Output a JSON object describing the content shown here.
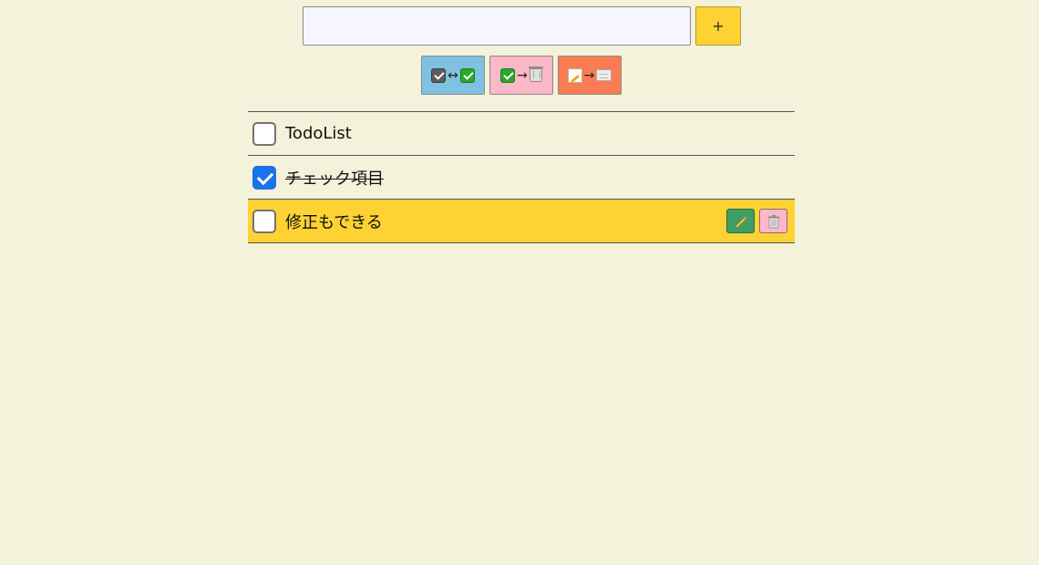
{
  "input": {
    "value": "",
    "placeholder": ""
  },
  "add_button": {
    "label": "+",
    "color": "#fed230"
  },
  "actions": [
    {
      "name": "toggle-all",
      "icons": [
        "check-box-gray-icon",
        "check-box-green-icon"
      ],
      "arrow": "↔",
      "color": "#7ec1e0"
    },
    {
      "name": "delete-checked",
      "icons": [
        "check-box-green-icon",
        "trash-icon"
      ],
      "arrow": "→",
      "color": "#fbb8c8"
    },
    {
      "name": "clear-all",
      "icons": [
        "memo-icon",
        "blank-sheet-icon"
      ],
      "arrow": "→",
      "color": "#fb7b52"
    }
  ],
  "todos": [
    {
      "text": "TodoList",
      "checked": false,
      "highlighted": false
    },
    {
      "text": "チェック項目",
      "checked": true,
      "highlighted": false
    },
    {
      "text": "修正もできる",
      "checked": false,
      "highlighted": true,
      "actions": [
        "pencil-icon",
        "trash-icon"
      ]
    }
  ],
  "colors": {
    "background": "#f4f2da",
    "highlight": "#fed233",
    "checkbox_checked": "#1a73e8",
    "edit_button": "#3f9e63",
    "delete_button": "#fbb8c8"
  }
}
